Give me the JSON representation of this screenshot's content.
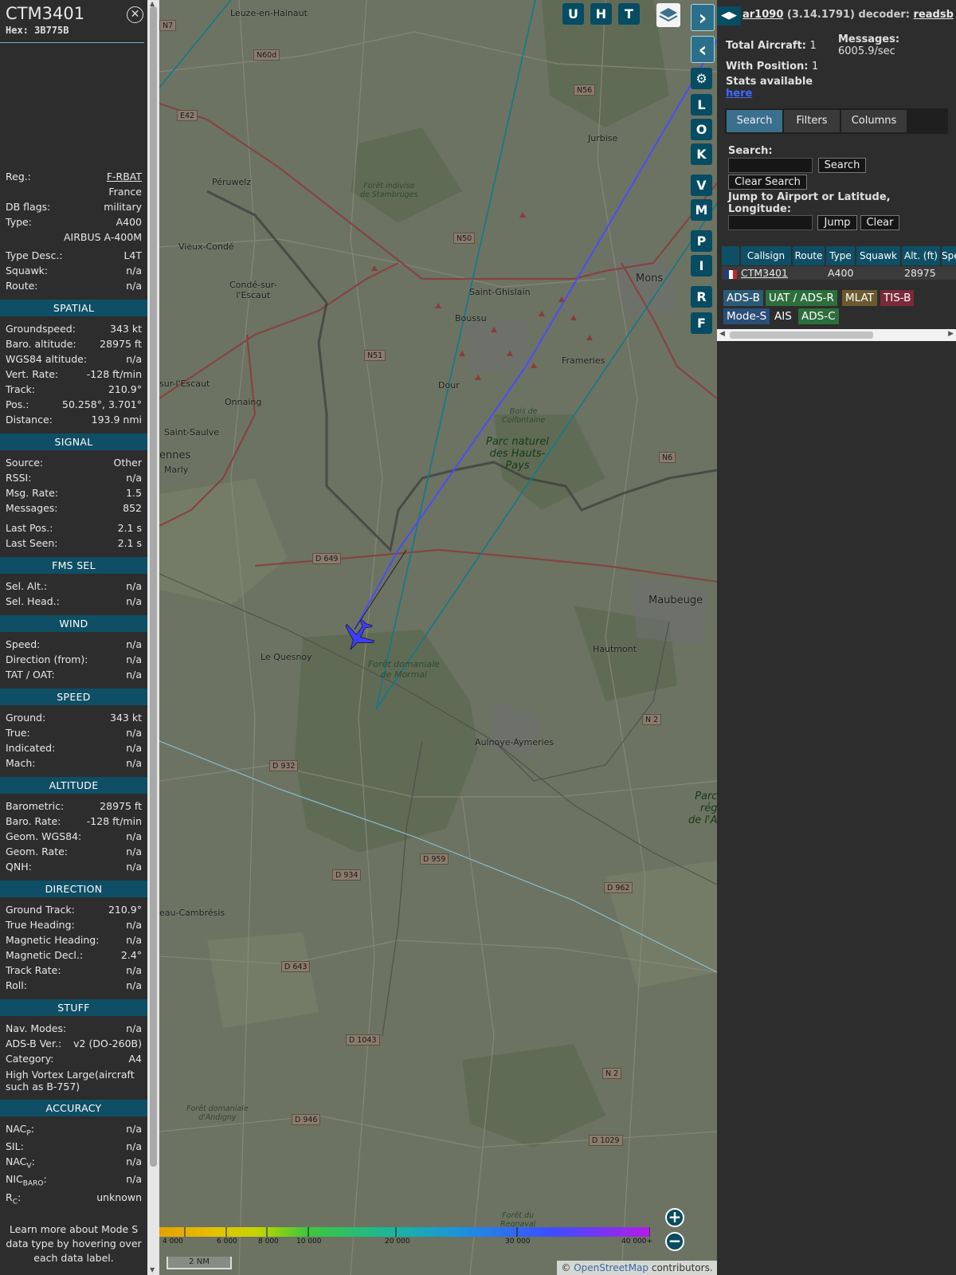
{
  "sidebar": {
    "callsign": "CTM3401",
    "hex": "Hex:  3B775B",
    "rows": [
      {
        "label": "Reg.:",
        "value": "F-RBAT"
      },
      {
        "label": "",
        "value": "France"
      },
      {
        "label": "DB flags:",
        "value": "military"
      },
      {
        "label": "Type:",
        "value": "A400"
      },
      {
        "label": "",
        "value": "AIRBUS A-400M"
      },
      {
        "label": "Type Desc.:",
        "value": "L4T"
      },
      {
        "label": "Squawk:",
        "value": "n/a"
      },
      {
        "label": "Route:",
        "value": "n/a"
      }
    ],
    "sections": {
      "spatial": "SPATIAL",
      "signal": "SIGNAL",
      "fms": "FMS SEL",
      "wind": "WIND",
      "speed": "SPEED",
      "altitude": "ALTITUDE",
      "direction": "DIRECTION",
      "stuff": "STUFF",
      "accuracy": "ACCURACY"
    },
    "spatial": [
      {
        "label": "Groundspeed:",
        "value": "343 kt"
      },
      {
        "label": "Baro. altitude:",
        "value": "28975 ft"
      },
      {
        "label": "WGS84 altitude:",
        "value": "n/a"
      },
      {
        "label": "Vert. Rate:",
        "value": "-128 ft/min"
      },
      {
        "label": "Track:",
        "value": "210.9°"
      },
      {
        "label": "Pos.:",
        "value": "50.258°, 3.701°"
      },
      {
        "label": "Distance:",
        "value": "193.9 nmi"
      }
    ],
    "signal": [
      {
        "label": "Source:",
        "value": "Other"
      },
      {
        "label": "RSSI:",
        "value": "n/a"
      },
      {
        "label": "Msg. Rate:",
        "value": "1.5"
      },
      {
        "label": "Messages:",
        "value": "852"
      },
      {
        "label": "Last Pos.:",
        "value": "2.1 s"
      },
      {
        "label": "Last Seen:",
        "value": "2.1 s"
      }
    ],
    "fms": [
      {
        "label": "Sel. Alt.:",
        "value": "n/a"
      },
      {
        "label": "Sel. Head.:",
        "value": "n/a"
      }
    ],
    "wind": [
      {
        "label": "Speed:",
        "value": "n/a"
      },
      {
        "label": "Direction (from):",
        "value": "n/a"
      },
      {
        "label": "TAT / OAT:",
        "value": "n/a"
      }
    ],
    "speed": [
      {
        "label": "Ground:",
        "value": "343 kt"
      },
      {
        "label": "True:",
        "value": "n/a"
      },
      {
        "label": "Indicated:",
        "value": "n/a"
      },
      {
        "label": "Mach:",
        "value": "n/a"
      }
    ],
    "altitude": [
      {
        "label": "Barometric:",
        "value": "28975 ft"
      },
      {
        "label": "Baro. Rate:",
        "value": "-128 ft/min"
      },
      {
        "label": "Geom. WGS84:",
        "value": "n/a"
      },
      {
        "label": "Geom. Rate:",
        "value": "n/a"
      },
      {
        "label": "QNH:",
        "value": "n/a"
      }
    ],
    "direction": [
      {
        "label": "Ground Track:",
        "value": "210.9°"
      },
      {
        "label": "True Heading:",
        "value": "n/a"
      },
      {
        "label": "Magnetic Heading:",
        "value": "n/a"
      },
      {
        "label": "Magnetic Decl.:",
        "value": "2.4°"
      },
      {
        "label": "Track Rate:",
        "value": "n/a"
      },
      {
        "label": "Roll:",
        "value": "n/a"
      }
    ],
    "stuff": [
      {
        "label": "Nav. Modes:",
        "value": "n/a"
      },
      {
        "label": "ADS-B Ver.:",
        "value": "v2 (DO-260B)"
      },
      {
        "label": "Category:",
        "value": "A4"
      }
    ],
    "category_desc": "High Vortex Large(aircraft such as B-757)",
    "accuracy": [
      {
        "label": "NAC",
        "sub": "P",
        "value": "n/a"
      },
      {
        "label": "SIL:",
        "sub": "",
        "value": "n/a"
      },
      {
        "label": "NAC",
        "sub": "V",
        "value": "n/a"
      },
      {
        "label": "NIC",
        "sub": "BARO",
        "value": "n/a"
      },
      {
        "label": "R",
        "sub": "C",
        "value": "unknown"
      }
    ],
    "learn_more": "Learn more about Mode S data type by hovering over each data label."
  },
  "map": {
    "buttons": [
      "U",
      "H",
      "T"
    ],
    "side_buttons": [
      "L",
      "O",
      "K",
      "V",
      "M",
      "P",
      "I",
      "R",
      "F"
    ],
    "towns": [
      {
        "id": "leuze",
        "name": "Leuze-en-Hainaut"
      },
      {
        "id": "jurbise",
        "name": "Jurbise"
      },
      {
        "id": "peruwelz",
        "name": "Péruwelz"
      },
      {
        "id": "vieux-conde",
        "name": "Vieux-Condé"
      },
      {
        "id": "conde",
        "name": "Condé-sur-\nl'Escaut"
      },
      {
        "id": "saint-ghislain",
        "name": "Saint-Ghislain"
      },
      {
        "id": "mons",
        "name": "Mons"
      },
      {
        "id": "boussu",
        "name": "Boussu"
      },
      {
        "id": "frameries",
        "name": "Frameries"
      },
      {
        "id": "escaut",
        "name": "sur-l'Escaut"
      },
      {
        "id": "onnaing",
        "name": "Onnaing"
      },
      {
        "id": "dour",
        "name": "Dour"
      },
      {
        "id": "saint-saulve",
        "name": "Saint-Saulve"
      },
      {
        "id": "ennes",
        "name": "ennes"
      },
      {
        "id": "marly",
        "name": "Marly"
      },
      {
        "id": "maubeuge",
        "name": "Maubeuge"
      },
      {
        "id": "hautmont",
        "name": "Hautmont"
      },
      {
        "id": "le-quesnoy",
        "name": "Le Quesnoy"
      },
      {
        "id": "aulnoye",
        "name": "Aulnoye-Aymeries"
      },
      {
        "id": "cambresis",
        "name": "eau-Cambrésis"
      }
    ],
    "forests": [
      {
        "id": "stambruges",
        "name": "Forêt indivise\nde Stambruges"
      },
      {
        "id": "colfontaine",
        "name": "Bois de\nColfontaine"
      },
      {
        "id": "mormal",
        "name": "Forêt domaniale\nde Mormal"
      },
      {
        "id": "andigny",
        "name": "Forêt domaniale\nd'Andigny"
      },
      {
        "id": "regnaval",
        "name": "Forêt du\nRegnaval"
      }
    ],
    "park": "Parc naturel\ndes Hauts-\nPays",
    "park2": "Parc\nrég\nde l'A",
    "shields": [
      "N7",
      "N60d",
      "E42",
      "N56",
      "N50",
      "N51",
      "D 649",
      "N6",
      "N 2",
      "D 932",
      "D 959",
      "D 934",
      "D 962",
      "D 643",
      "D 1043",
      "N 2",
      "D 946",
      "D 1029"
    ],
    "alt_scale": [
      "4 000",
      "6 000",
      "8 000",
      "10 000",
      "20 000",
      "30 000",
      "40 000+"
    ],
    "nm_scale": "2 NM",
    "attribution_prefix": "© ",
    "attribution_link": "OpenStreetMap",
    "attribution_suffix": " contributors."
  },
  "right": {
    "title_name": "ar1090",
    "title_version": "(3.14.1791) decoder: ",
    "title_decoder": "readsb",
    "total_label": "Total Aircraft: ",
    "total_value": "1",
    "with_pos_label": "With Position: ",
    "with_pos_value": "1",
    "messages_label": "Messages:",
    "messages_value": "6005.9/sec",
    "stats_label": "Stats available",
    "stats_link": "here",
    "tabs": [
      "Search",
      "Filters",
      "Columns"
    ],
    "search_label": "Search:",
    "search_button": "Search",
    "clear_search": "Clear Search",
    "jump_label": "Jump to Airport or Latitude,\nLongitude:",
    "jump_button": "Jump",
    "clear_button": "Clear",
    "columns": [
      "Callsign",
      "Route",
      "Type",
      "Squawk",
      "Alt. (ft)",
      "Spe"
    ],
    "rows": [
      {
        "callsign": "CTM3401",
        "route": "",
        "type": "A400",
        "squawk": "",
        "alt": "28975"
      }
    ],
    "badges": [
      "ADS-B",
      "UAT / ADS-R",
      "MLAT",
      "TIS-B",
      "Mode-S",
      "AIS",
      "ADS-C"
    ],
    "colors": {
      "accent": "#0f4f65",
      "track": "#4b4bff",
      "aircraft": "#3d3dff"
    }
  }
}
